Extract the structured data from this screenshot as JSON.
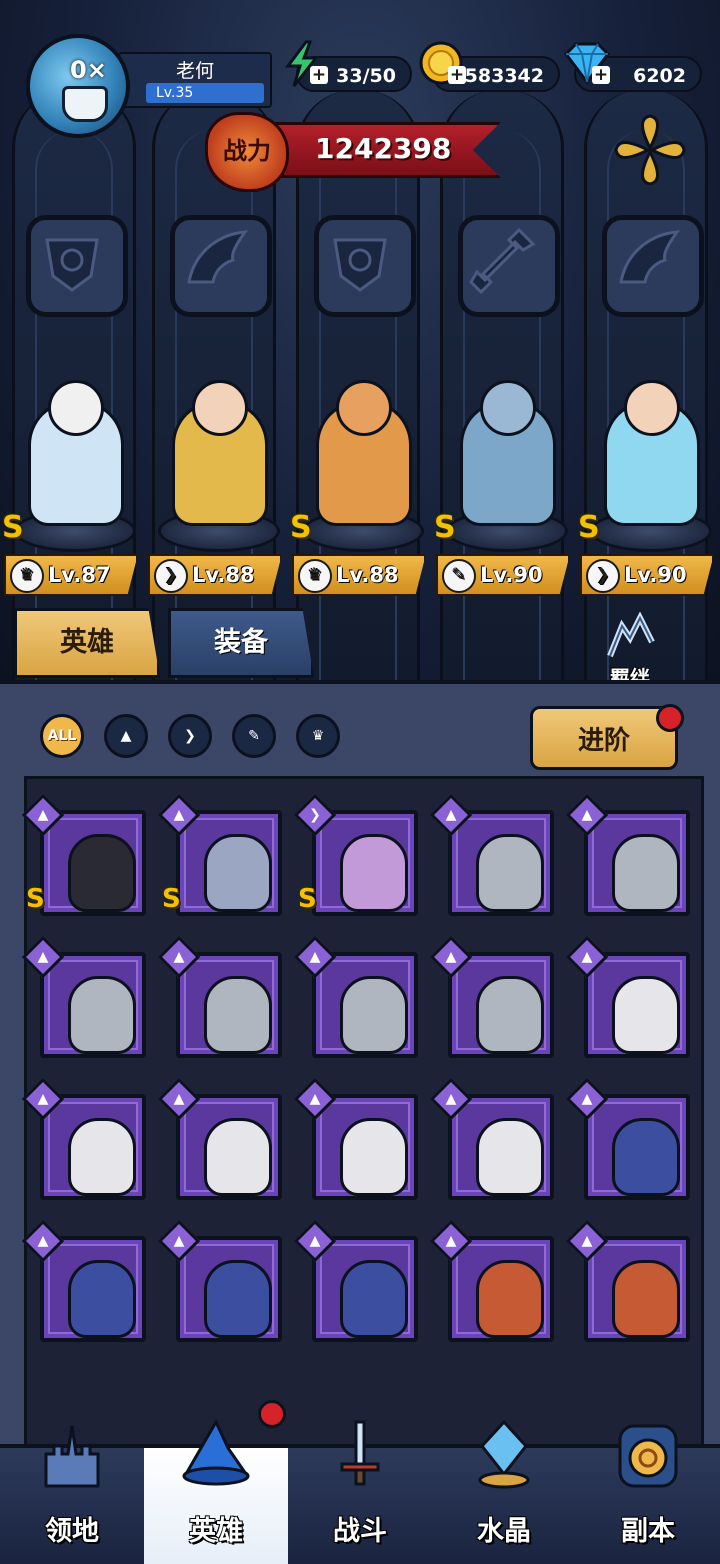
{
  "player": {
    "name": "老何",
    "level": "Lv.35",
    "avatar_badge": "0×"
  },
  "resources": {
    "stamina": "33/50",
    "gold": "1583342",
    "diamonds": "6202"
  },
  "power": {
    "label": "战力",
    "value": "1242398"
  },
  "team": [
    {
      "class": "warrior",
      "rank": "S",
      "level": "Lv.87",
      "color": "#cfe4f5"
    },
    {
      "class": "wing",
      "rank": "",
      "level": "Lv.88",
      "color": "#e2b94a"
    },
    {
      "class": "warrior",
      "rank": "S",
      "level": "Lv.88",
      "color": "#e29a4a"
    },
    {
      "class": "wrench",
      "rank": "S",
      "level": "Lv.90",
      "color": "#7da7c9"
    },
    {
      "class": "wing",
      "rank": "S",
      "level": "Lv.90",
      "color": "#8fd8f0"
    }
  ],
  "tabs": {
    "hero": "英雄",
    "equipment": "装备"
  },
  "bond_label": "羁绊",
  "filters": {
    "all": "ALL"
  },
  "advance_label": "进阶",
  "nav": {
    "territory": "领地",
    "hero": "英雄",
    "battle": "战斗",
    "crystal": "水晶",
    "dungeon": "副本"
  },
  "roster": [
    {
      "face": "ninja",
      "rank": "S",
      "tag": "▲"
    },
    {
      "face": "vampire",
      "rank": "S",
      "tag": "▲"
    },
    {
      "face": "succubus",
      "rank": "S",
      "tag": "❯"
    },
    {
      "face": "knight",
      "rank": "",
      "tag": "▲"
    },
    {
      "face": "knight",
      "rank": "",
      "tag": "▲"
    },
    {
      "face": "knight",
      "rank": "",
      "tag": "▲"
    },
    {
      "face": "knight",
      "rank": "",
      "tag": "▲"
    },
    {
      "face": "knight",
      "rank": "",
      "tag": "▲"
    },
    {
      "face": "knight",
      "rank": "",
      "tag": "▲"
    },
    {
      "face": "nun",
      "rank": "",
      "tag": "▲"
    },
    {
      "face": "nun",
      "rank": "",
      "tag": "▲"
    },
    {
      "face": "nun",
      "rank": "",
      "tag": "▲"
    },
    {
      "face": "nun",
      "rank": "",
      "tag": "▲"
    },
    {
      "face": "nun",
      "rank": "",
      "tag": "▲"
    },
    {
      "face": "wizard",
      "rank": "",
      "tag": "▲"
    },
    {
      "face": "wizard",
      "rank": "",
      "tag": "▲"
    },
    {
      "face": "wizard",
      "rank": "",
      "tag": "▲"
    },
    {
      "face": "wizard",
      "rank": "",
      "tag": "▲"
    },
    {
      "face": "dwarf",
      "rank": "",
      "tag": "▲"
    },
    {
      "face": "dwarf",
      "rank": "",
      "tag": "▲"
    }
  ]
}
